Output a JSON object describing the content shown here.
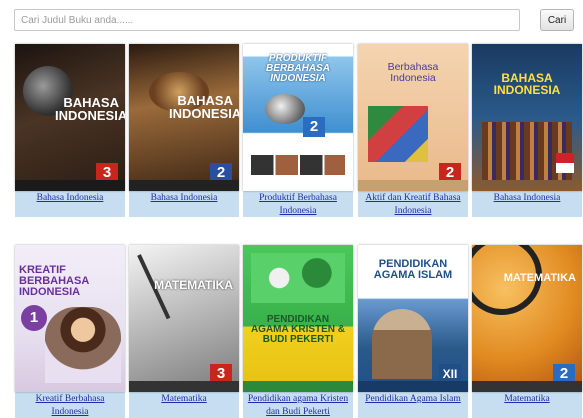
{
  "search": {
    "placeholder": "Cari Judul Buku anda......",
    "button_label": "Cari"
  },
  "books": [
    {
      "title": "Bahasa Indonesia",
      "cover_title": "BAHASA INDONESIA",
      "number": "3",
      "colors": {
        "bg": "#3b2a20",
        "accent": "#c8261d"
      }
    },
    {
      "title": "Bahasa Indonesia",
      "cover_title": "BAHASA INDONESIA",
      "number": "2",
      "colors": {
        "bg": "#6b4a2a",
        "accent": "#2a4ea0"
      }
    },
    {
      "title": "Produktif Berbahasa Indonesia",
      "cover_title": "PRODUKTIF BERBAHASA INDONESIA",
      "number": "2",
      "colors": {
        "bg": "#5aa0d8",
        "accent": "#2a6cc0"
      }
    },
    {
      "title": "Aktif dan Kreatif Bahasa Indonesia",
      "cover_title": "Berbahasa Indonesia",
      "number": "2",
      "colors": {
        "bg": "#e9b98a",
        "accent": "#c8261d"
      }
    },
    {
      "title": "Bahasa Indonesia",
      "cover_title": "BAHASA INDONESIA",
      "number": "",
      "colors": {
        "bg": "#2a4f7a",
        "accent": "#d0202a"
      }
    },
    {
      "title": "Kreatif Berbahasa Indonesia",
      "cover_title": "KREATIF BERBAHASA INDONESIA",
      "number": "1",
      "colors": {
        "bg": "#e7e0f0",
        "accent": "#7a3fa0"
      }
    },
    {
      "title": "Matematika",
      "cover_title": "MATEMATIKA",
      "number": "3",
      "colors": {
        "bg": "#9a9a9a",
        "accent": "#c8261d"
      }
    },
    {
      "title": "Pendidikan agama Kristen dan Budi Pekerti",
      "cover_title": "PENDIDIKAN AGAMA KRISTEN & BUDI PEKERTI",
      "number": "",
      "colors": {
        "bg": "#3ab14a",
        "accent": "#e8d020"
      }
    },
    {
      "title": "Pendidikan Agama Islam",
      "cover_title": "PENDIDIKAN AGAMA ISLAM",
      "number": "XII",
      "colors": {
        "bg": "#1f4f86",
        "accent": "#1f4f86"
      }
    },
    {
      "title": "Matematika",
      "cover_title": "MATEMATIKA",
      "number": "2",
      "colors": {
        "bg": "#e08a20",
        "accent": "#2a6cc0"
      }
    }
  ]
}
